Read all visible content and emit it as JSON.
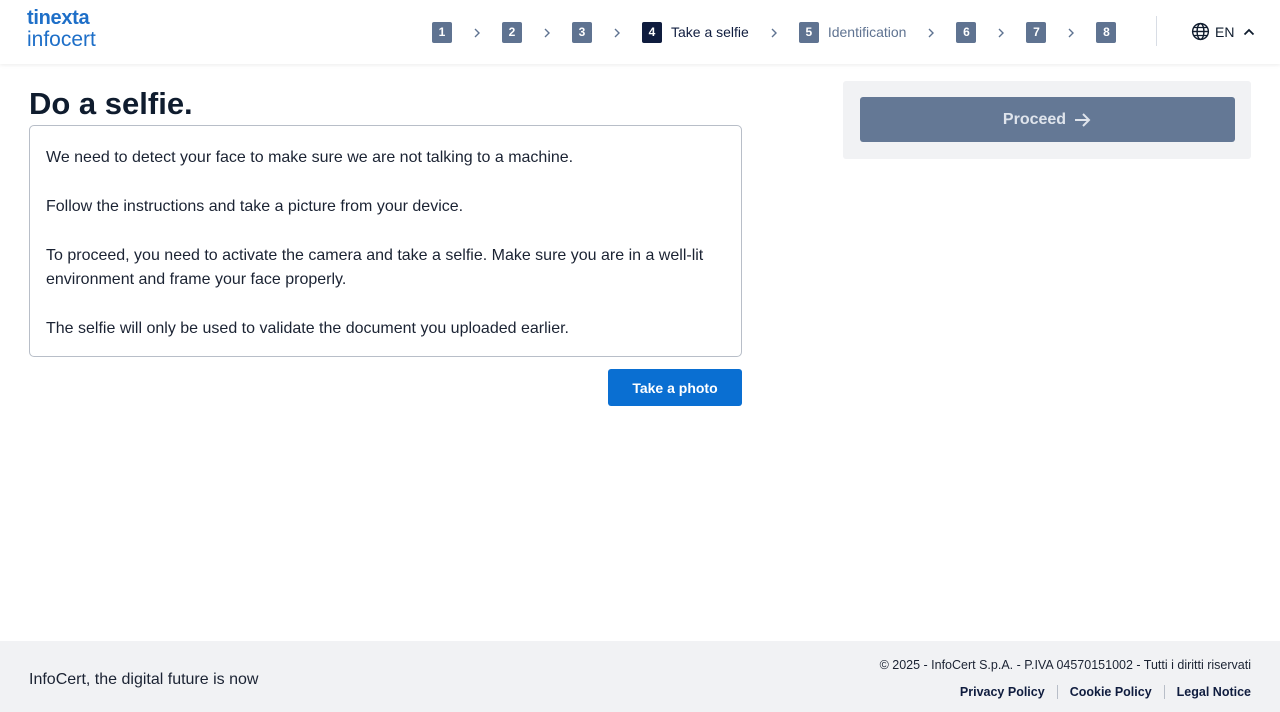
{
  "header": {
    "logo_top": "tinexta",
    "logo_bottom": "infocert",
    "steps": [
      {
        "num": "1",
        "label": ""
      },
      {
        "num": "2",
        "label": ""
      },
      {
        "num": "3",
        "label": ""
      },
      {
        "num": "4",
        "label": "Take a selfie"
      },
      {
        "num": "5",
        "label": "Identification"
      },
      {
        "num": "6",
        "label": ""
      },
      {
        "num": "7",
        "label": ""
      },
      {
        "num": "8",
        "label": ""
      }
    ],
    "active_step": "4",
    "language": "EN"
  },
  "main": {
    "title": "Do a selfie.",
    "paragraphs": [
      "We need to detect your face to make sure we are not talking to a machine.",
      "Follow the instructions and take a picture from your device.",
      "To proceed, you need to activate the camera and take a selfie. Make sure you are in a well-lit environment and frame your face properly.",
      "The selfie will only be used to validate the document you uploaded earlier."
    ],
    "take_photo_label": "Take a photo"
  },
  "side": {
    "proceed_label": "Proceed"
  },
  "footer": {
    "tagline": "InfoCert, the digital future is now",
    "copyright": "© 2025 - InfoCert S.p.A. - P.IVA 04570151002 - Tutti i diritti riservati",
    "links": [
      "Privacy Policy",
      "Cookie Policy",
      "Legal Notice"
    ]
  },
  "colors": {
    "brand": "#1e6fc8",
    "primary_button": "#0a6fd2",
    "step_inactive": "#5f7391",
    "step_active": "#0f1c3e",
    "disabled_button": "#647895"
  },
  "icons": {
    "language": "globe-icon",
    "language_toggle": "chevron-up-icon",
    "proceed": "arrow-right-icon",
    "step_separator": "chevron-right-icon"
  }
}
